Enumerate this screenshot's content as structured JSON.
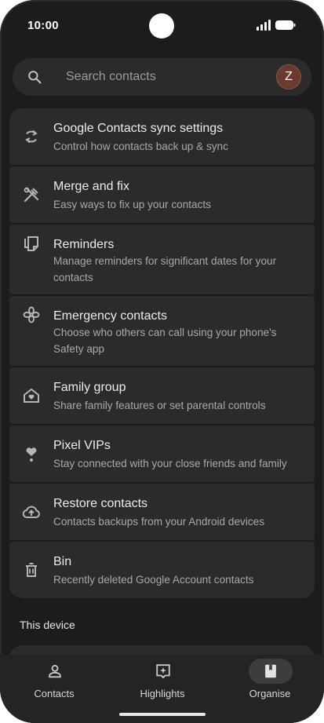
{
  "status_bar": {
    "time": "10:00"
  },
  "search": {
    "placeholder": "Search contacts",
    "avatar_letter": "Z"
  },
  "menu": [
    {
      "icon": "sync-icon",
      "title": "Google Contacts sync settings",
      "subtitle": "Control how contacts back up & sync"
    },
    {
      "icon": "merge-fix-icon",
      "title": "Merge and fix",
      "subtitle": "Easy ways to fix up your contacts"
    },
    {
      "icon": "reminders-icon",
      "title": "Reminders",
      "subtitle": "Manage reminders for significant dates for your contacts"
    },
    {
      "icon": "emergency-icon",
      "title": "Emergency contacts",
      "subtitle": "Choose who others can call using your phone's Safety app"
    },
    {
      "icon": "family-home-icon",
      "title": "Family group",
      "subtitle": "Share family features or set parental controls"
    },
    {
      "icon": "heart-pin-icon",
      "title": "Pixel VIPs",
      "subtitle": "Stay connected with your close friends and family"
    },
    {
      "icon": "cloud-restore-icon",
      "title": "Restore contacts",
      "subtitle": "Contacts backups from your Android devices"
    },
    {
      "icon": "trash-icon",
      "title": "Bin",
      "subtitle": "Recently deleted Google Account contacts"
    }
  ],
  "section_heading": "This device",
  "bottom_nav": [
    {
      "icon": "person-icon",
      "label": "Contacts",
      "active": false
    },
    {
      "icon": "highlights-icon",
      "label": "Highlights",
      "active": false
    },
    {
      "icon": "bookmark-icon",
      "label": "Organise",
      "active": true
    }
  ],
  "colors": {
    "background": "#1b1c1b",
    "card": "#2a2b2a",
    "text": "#ececec",
    "subtext": "#a9aaa8"
  }
}
